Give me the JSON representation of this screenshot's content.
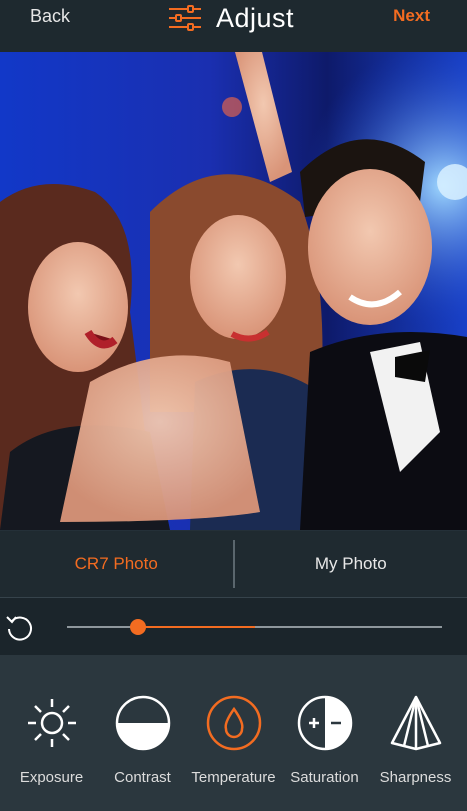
{
  "header": {
    "back_label": "Back",
    "title": "Adjust",
    "next_label": "Next"
  },
  "tabs": [
    {
      "label": "CR7 Photo",
      "active": true
    },
    {
      "label": "My Photo",
      "active": false
    }
  ],
  "slider": {
    "value": 0.19,
    "fill_end": 0.5
  },
  "tools": [
    {
      "label": "Exposure",
      "icon": "sun-icon"
    },
    {
      "label": "Contrast",
      "icon": "contrast-icon"
    },
    {
      "label": "Temperature",
      "icon": "drop-icon",
      "active": true
    },
    {
      "label": "Saturation",
      "icon": "saturation-icon"
    },
    {
      "label": "Sharpness",
      "icon": "pyramid-icon"
    }
  ],
  "colors": {
    "accent": "#f36c21",
    "background": "#243038"
  }
}
